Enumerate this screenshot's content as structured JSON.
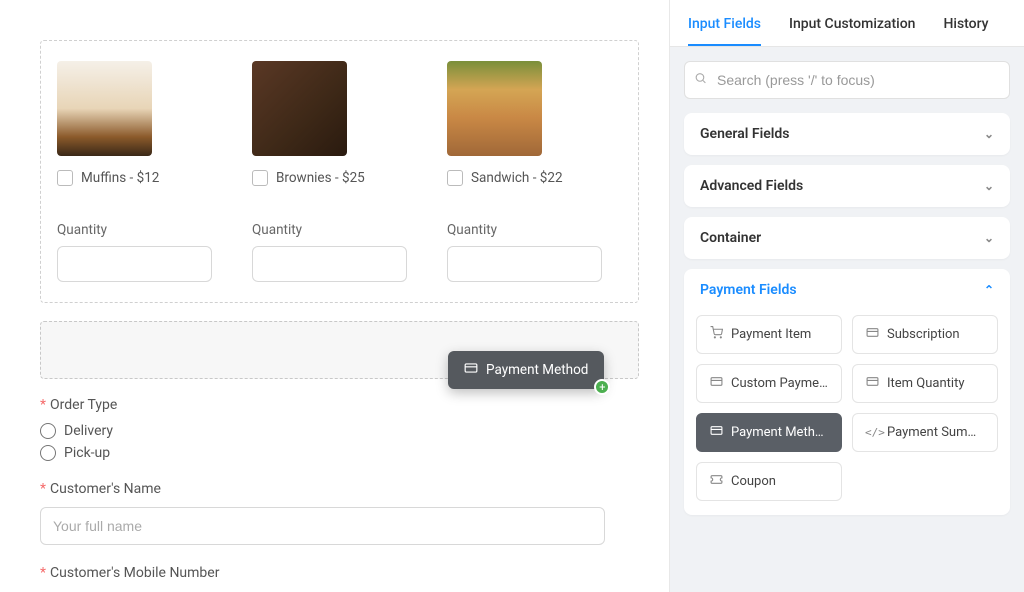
{
  "products": [
    {
      "label": "Muffins - $12",
      "qty_label": "Quantity"
    },
    {
      "label": "Brownies - $25",
      "qty_label": "Quantity"
    },
    {
      "label": "Sandwich - $22",
      "qty_label": "Quantity"
    }
  ],
  "drag": {
    "label": "Payment Method"
  },
  "order_type": {
    "title": "Order Type",
    "options": [
      "Delivery",
      "Pick-up"
    ]
  },
  "customer_name": {
    "title": "Customer's Name",
    "placeholder": "Your full name"
  },
  "customer_mobile": {
    "title": "Customer's Mobile Number"
  },
  "tabs": [
    "Input Fields",
    "Input Customization",
    "History"
  ],
  "search_placeholder": "Search (press '/' to focus)",
  "sections": {
    "general": "General Fields",
    "advanced": "Advanced Fields",
    "container": "Container",
    "payment": "Payment Fields"
  },
  "payment_items": [
    {
      "icon": "🛒",
      "label": "Payment Item"
    },
    {
      "icon": "💳",
      "label": "Subscription"
    },
    {
      "icon": "💳",
      "label": "Custom Paymen…"
    },
    {
      "icon": "💳",
      "label": "Item Quantity"
    },
    {
      "icon": "💳",
      "label": "Payment Method"
    },
    {
      "icon": "</>",
      "label": "Payment Summa…"
    },
    {
      "icon": "🎟",
      "label": "Coupon"
    }
  ]
}
